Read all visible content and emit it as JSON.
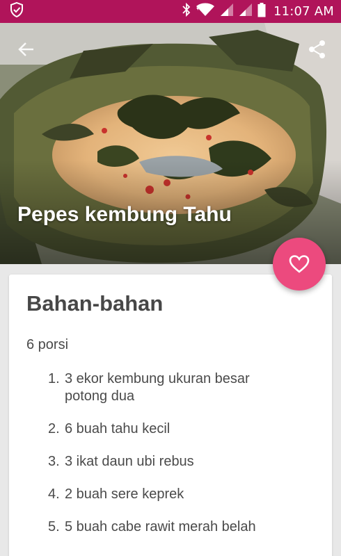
{
  "status_bar": {
    "time": "11:07 AM",
    "icons": [
      "shield-check-icon",
      "bluetooth-icon",
      "wifi-icon",
      "signal-icon",
      "signal-icon",
      "battery-icon"
    ]
  },
  "hero": {
    "title": "Pepes kembung Tahu",
    "back_icon": "arrow-left-icon",
    "share_icon": "share-icon"
  },
  "favorite_icon": "heart-outline-icon",
  "ingredients_section": {
    "title": "Bahan-bahan",
    "servings": "6 porsi",
    "items": [
      {
        "num": "1.",
        "text": "3 ekor kembung ukuran besar potong dua"
      },
      {
        "num": "2.",
        "text": "6 buah tahu kecil"
      },
      {
        "num": "3.",
        "text": "3 ikat daun ubi rebus"
      },
      {
        "num": "4.",
        "text": "2 buah sere keprek"
      },
      {
        "num": "5.",
        "text": "5 buah cabe rawit merah belah"
      }
    ]
  },
  "colors": {
    "status_bar": "#b0145a",
    "fab": "#ec4a7e",
    "background": "#e8e8e8"
  }
}
